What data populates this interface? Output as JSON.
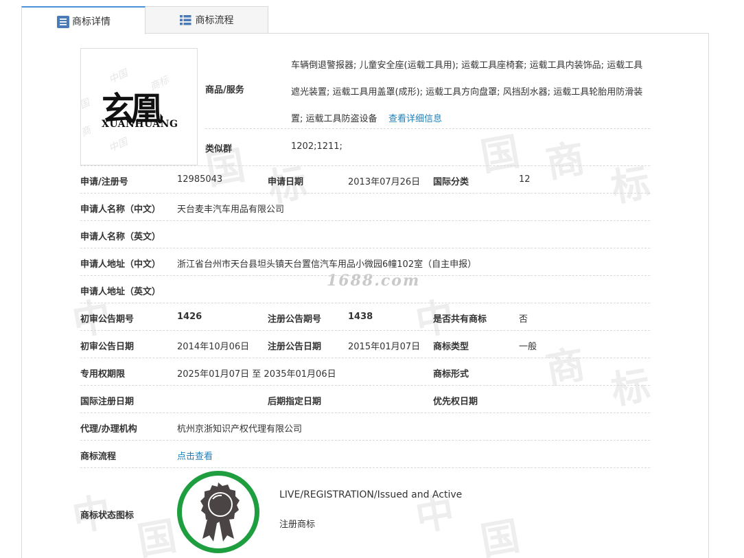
{
  "tabs": [
    {
      "label": "商标详情",
      "icon": "document-list-icon",
      "active": true
    },
    {
      "label": "商标流程",
      "icon": "list-icon",
      "active": false
    }
  ],
  "logo": {
    "main": "玄凰",
    "sub": "XUANHUANG"
  },
  "watermark": "1688.com",
  "goods": {
    "label": "商品/服务",
    "text": "车辆倒退警报器; 儿童安全座(运载工具用); 运载工具座椅套; 运载工具内装饰品; 运载工具遮光装置; 运载工具用盖罩(成形); 运载工具方向盘罩; 风挡刮水器; 运载工具轮胎用防滑装置; 运载工具防盗设备",
    "more_link": "查看详细信息"
  },
  "similar_group": {
    "label": "类似群",
    "value": "1202;1211;"
  },
  "rows": {
    "reg_no_label": "申请/注册号",
    "reg_no": "12985043",
    "apply_date_label": "申请日期",
    "apply_date": "2013年07月26日",
    "intl_class_label": "国际分类",
    "intl_class": "12",
    "applicant_cn_label": "申请人名称（中文）",
    "applicant_cn": "天台麦丰汽车用品有限公司",
    "applicant_en_label": "申请人名称（英文）",
    "applicant_en": "",
    "address_cn_label": "申请人地址（中文）",
    "address_cn": "浙江省台州市天台县坦头镇天台置信汽车用品小微园6幢102室（自主申报）",
    "address_en_label": "申请人地址（英文）",
    "address_en": "",
    "prelim_no_label": "初审公告期号",
    "prelim_no": "1426",
    "reg_pub_no_label": "注册公告期号",
    "reg_pub_no": "1438",
    "shared_label": "是否共有商标",
    "shared": "否",
    "prelim_date_label": "初审公告日期",
    "prelim_date": "2014年10月06日",
    "reg_pub_date_label": "注册公告日期",
    "reg_pub_date": "2015年01月07日",
    "tm_type_label": "商标类型",
    "tm_type": "一般",
    "term_label": "专用权期限",
    "term": "2025年01月07日 至 2035年01月06日",
    "tm_form_label": "商标形式",
    "tm_form": "",
    "intl_reg_date_label": "国际注册日期",
    "intl_reg_date": "",
    "later_date_label": "后期指定日期",
    "later_date": "",
    "priority_label": "优先权日期",
    "priority": "",
    "agent_label": "代理/办理机构",
    "agent": "杭州京浙知识产权代理有限公司",
    "flow_label": "商标流程",
    "flow_link": "点击查看",
    "status_label": "商标状态图标",
    "status_en": "LIVE/REGISTRATION/Issued and Active",
    "status_cn": "注册商标"
  },
  "colors": {
    "accent": "#4a90d9",
    "link": "#1f7fb8",
    "badge_ring": "#1e9e3e",
    "badge_medal": "#4a4444"
  }
}
